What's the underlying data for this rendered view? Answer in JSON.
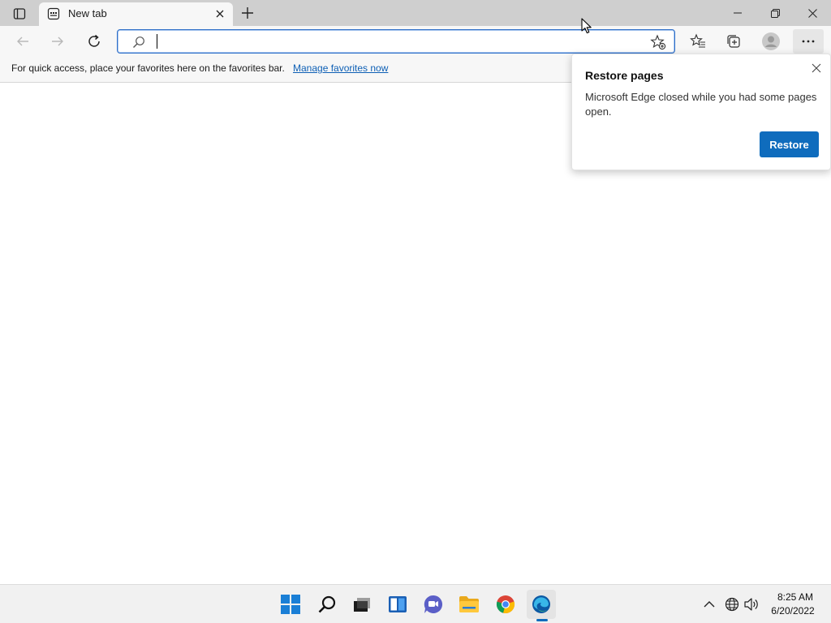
{
  "window": {
    "tab_title": "New tab"
  },
  "address_bar": {
    "value": "",
    "placeholder": ""
  },
  "favorites_bar": {
    "message": "For quick access, place your favorites here on the favorites bar.",
    "link_label": "Manage favorites now"
  },
  "restore_popup": {
    "title": "Restore pages",
    "message": "Microsoft Edge closed while you had some pages open.",
    "button_label": "Restore"
  },
  "taskbar": {
    "apps": [
      "start",
      "search",
      "task-view",
      "widgets",
      "teams-chat",
      "file-explorer",
      "chrome",
      "edge"
    ],
    "clock_time": "8:25 AM",
    "clock_date": "6/20/2022"
  },
  "colors": {
    "accent": "#0f6cbd",
    "link": "#0d5fb5",
    "titlebar": "#cfcfcf"
  }
}
